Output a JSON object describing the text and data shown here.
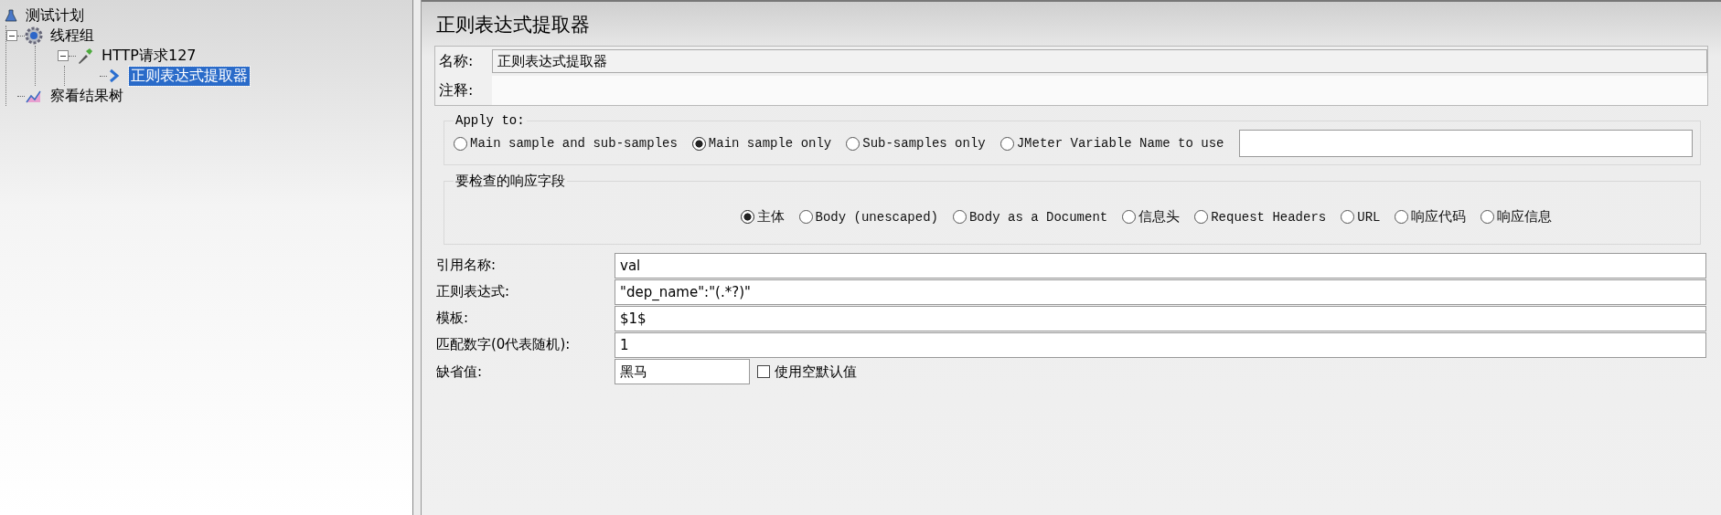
{
  "tree": [
    {
      "label": "测试计划",
      "kind": "plan",
      "selected": false,
      "children": [
        {
          "label": "线程组",
          "kind": "thread-group",
          "selected": false,
          "expanded": true,
          "children": [
            {
              "label": "HTTP请求127",
              "kind": "sampler",
              "selected": false,
              "expanded": true,
              "children": [
                {
                  "label": "正则表达式提取器",
                  "kind": "extractor",
                  "selected": true
                }
              ]
            }
          ]
        },
        {
          "label": "察看结果树",
          "kind": "listener",
          "selected": false
        }
      ]
    }
  ],
  "panel": {
    "title": "正则表达式提取器",
    "name": {
      "label": "名称:",
      "value": "正则表达式提取器"
    },
    "comment": {
      "label": "注释:"
    },
    "apply_to": {
      "title": "Apply to:",
      "options": [
        {
          "label": "Main sample and sub-samples",
          "selected": false
        },
        {
          "label": "Main sample only",
          "selected": true
        },
        {
          "label": "Sub-samples only",
          "selected": false
        },
        {
          "label": "JMeter Variable Name to use",
          "selected": false
        }
      ]
    },
    "response_field": {
      "title": "要检查的响应字段",
      "options": [
        {
          "label": "主体",
          "selected": true
        },
        {
          "label": "Body (unescaped)",
          "selected": false
        },
        {
          "label": "Body as a Document",
          "selected": false
        },
        {
          "label": "信息头",
          "selected": false
        },
        {
          "label": "Request Headers",
          "selected": false
        },
        {
          "label": "URL",
          "selected": false
        },
        {
          "label": "响应代码",
          "selected": false
        },
        {
          "label": "响应信息",
          "selected": false
        }
      ]
    },
    "fields": [
      {
        "label": "引用名称:",
        "value": "val"
      },
      {
        "label": "正则表达式:",
        "value": "\"dep_name\":\"(.*?)\""
      },
      {
        "label": "模板:",
        "value": "$1$"
      },
      {
        "label": "匹配数字(0代表随机):",
        "value": "1"
      }
    ],
    "default_value": {
      "label": "缺省值:",
      "value": "黑马",
      "checkbox": {
        "label": "使用空默认值",
        "checked": false
      }
    }
  }
}
